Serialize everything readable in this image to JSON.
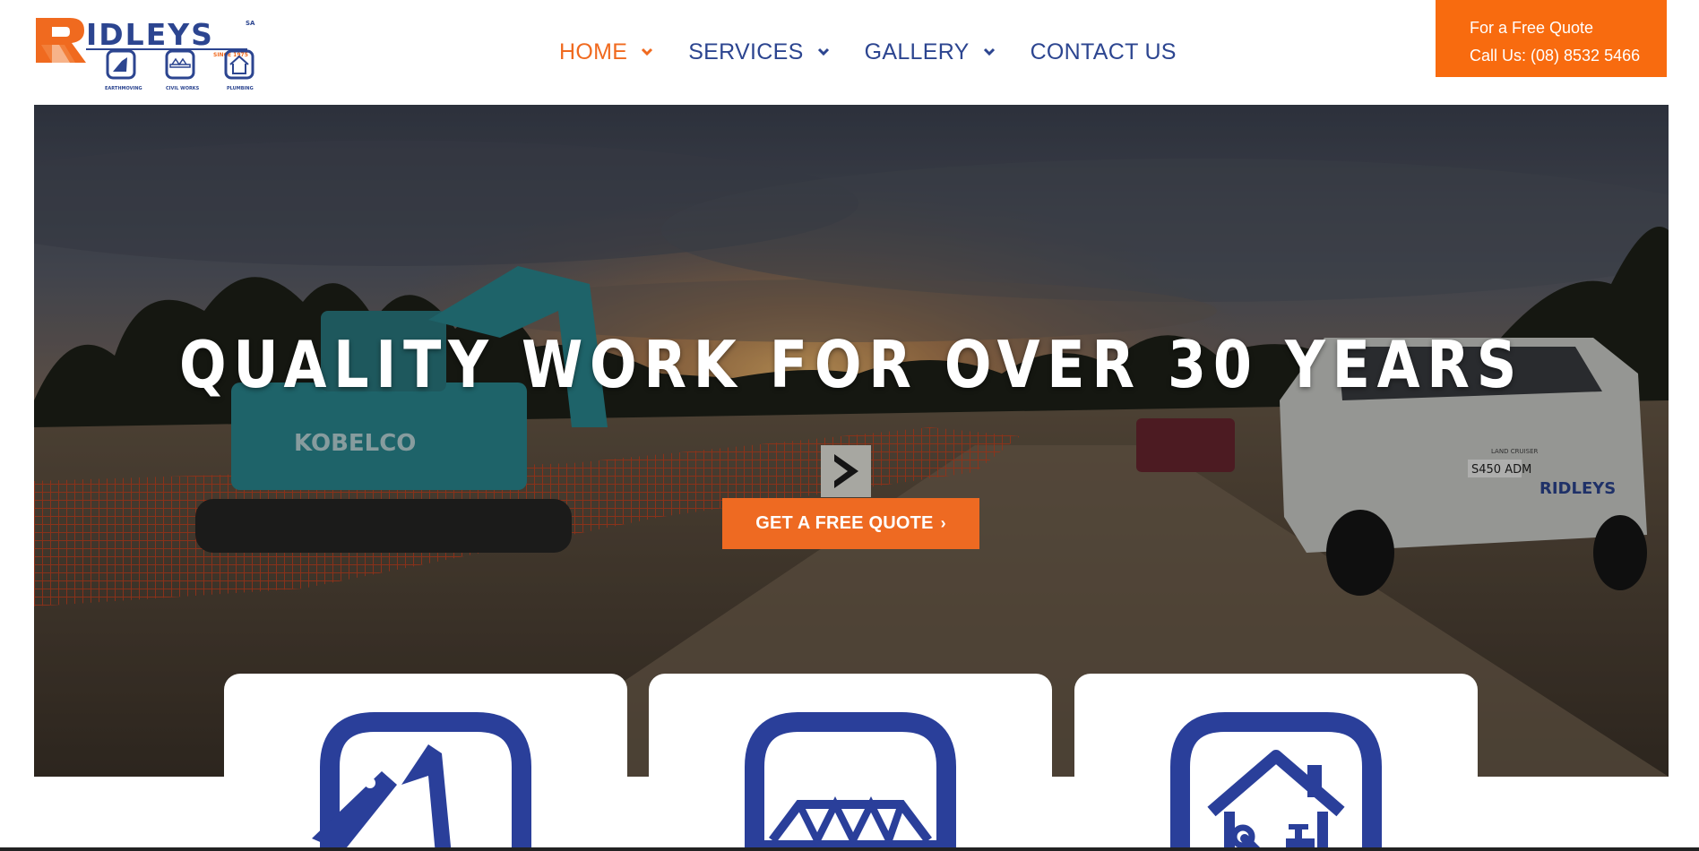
{
  "header": {
    "logo": {
      "brand": "RIDLEYS",
      "region": "SA",
      "since": "SINCE 1975",
      "captions": [
        "EARTHMOVING",
        "CIVIL WORKS",
        "PLUMBING"
      ]
    },
    "nav": [
      {
        "label": "HOME",
        "active": true,
        "has_dropdown": true
      },
      {
        "label": "SERVICES",
        "active": false,
        "has_dropdown": true
      },
      {
        "label": "GALLERY",
        "active": false,
        "has_dropdown": true
      },
      {
        "label": "CONTACT US",
        "active": false,
        "has_dropdown": false
      }
    ],
    "quote": {
      "line1": "For a Free Quote",
      "line2": "Call Us: (08) 8532 5466"
    }
  },
  "hero": {
    "title": "QUALITY WORK FOR OVER 30 YEARS",
    "cta_label": "GET A FREE QUOTE",
    "photo_text": {
      "excavator_brand": "KOBELCO",
      "vehicle_plate": "S450 ADM",
      "vehicle_model": "LAND CRUISER",
      "vehicle_brand": "RIDLEYS"
    }
  },
  "services": [
    {
      "icon": "excavator-icon"
    },
    {
      "icon": "bridge-icon"
    },
    {
      "icon": "plumbing-house-icon"
    }
  ],
  "colors": {
    "brand_blue": "#2c4590",
    "brand_orange": "#f06a1f",
    "quote_orange": "#f86b0f",
    "icon_blue": "#2a3f9a"
  }
}
